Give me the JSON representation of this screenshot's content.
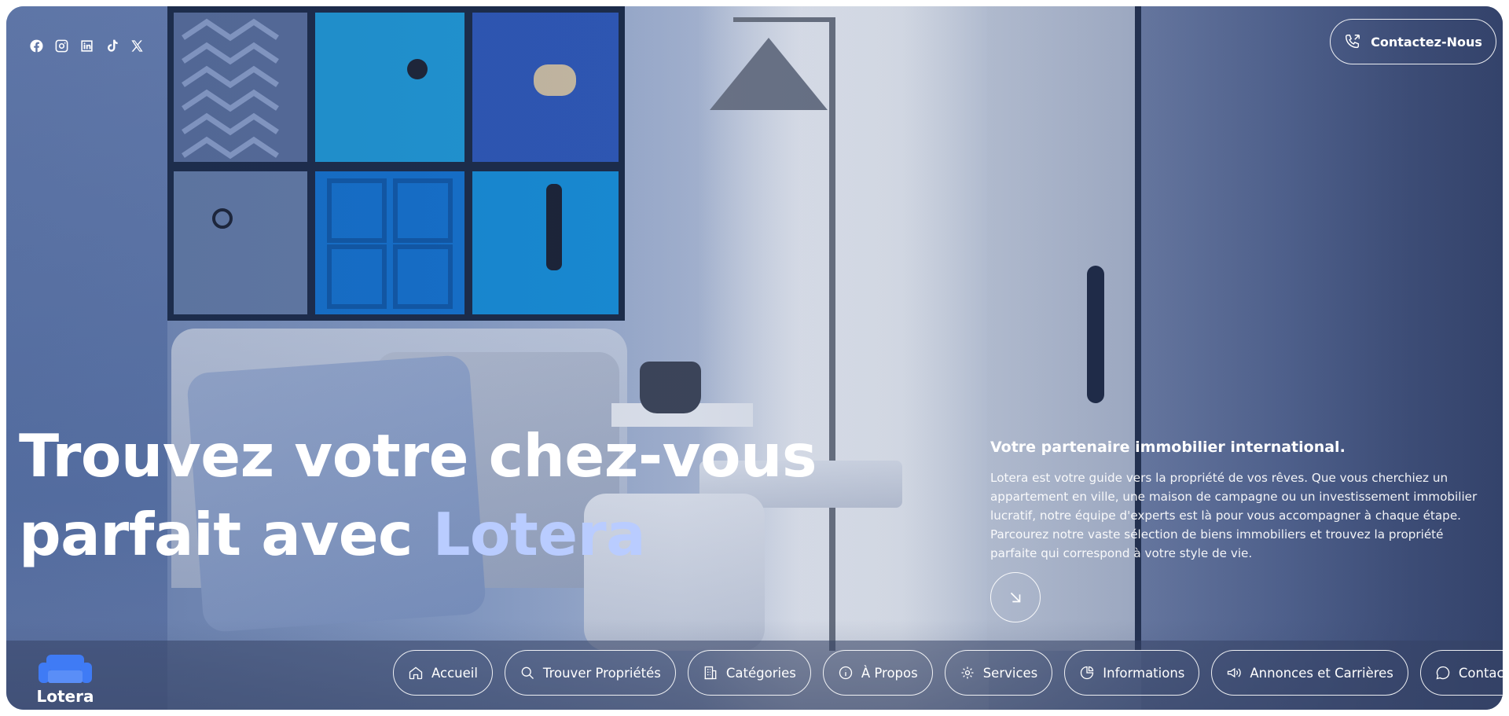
{
  "brand": {
    "name": "Lotera",
    "accent_color": "#b9ccff",
    "logo_color": "#3f7bf5"
  },
  "social": [
    {
      "name": "facebook-icon"
    },
    {
      "name": "instagram-icon"
    },
    {
      "name": "linkedin-icon"
    },
    {
      "name": "tiktok-icon"
    },
    {
      "name": "x-icon"
    }
  ],
  "header": {
    "contact_label": "Contactez-Nous"
  },
  "hero": {
    "title_line1": "Trouvez votre chez-vous",
    "title_line2_prefix": "parfait avec ",
    "title_line2_accent": "Lotera",
    "subtitle": "Votre partenaire immobilier international.",
    "body": "Lotera est votre guide vers la propriété de vos rêves. Que vous cherchiez un appartement en ville, une maison de campagne ou un investissement immobilier lucratif, notre équipe d'experts est là pour vous accompagner à chaque étape. Parcourez notre vaste sélection de biens immobiliers et trouvez la propriété parfaite qui correspond à votre style de vie."
  },
  "nav": {
    "items": [
      {
        "label": "Accueil",
        "icon": "home-icon"
      },
      {
        "label": "Trouver Propriétés",
        "icon": "search-icon"
      },
      {
        "label": "Catégories",
        "icon": "building-icon"
      },
      {
        "label": "À Propos",
        "icon": "info-icon"
      },
      {
        "label": "Services",
        "icon": "services-icon"
      },
      {
        "label": "Informations",
        "icon": "chart-icon"
      },
      {
        "label": "Annonces et Carrières",
        "icon": "megaphone-icon"
      },
      {
        "label": "Contact",
        "icon": "chat-icon"
      }
    ]
  }
}
